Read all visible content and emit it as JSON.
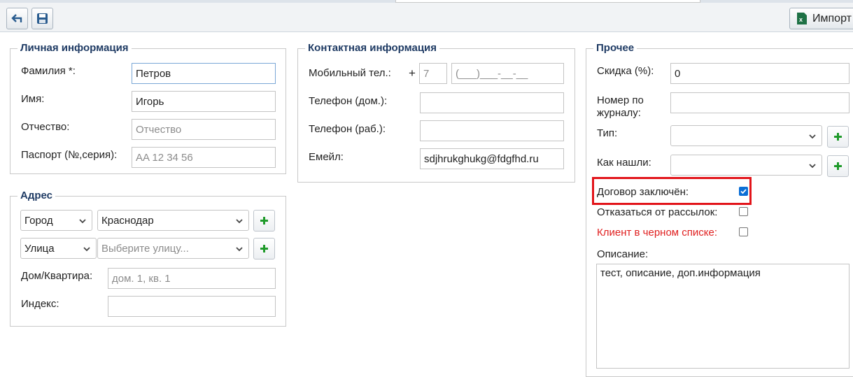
{
  "toolbar": {
    "back_icon": "arrow-back-icon",
    "save_icon": "floppy-disk-icon",
    "import_label": "Импорт",
    "import_icon": "excel-icon"
  },
  "personal": {
    "legend": "Личная информация",
    "lastname_label": "Фамилия *:",
    "lastname_value": "Петров",
    "firstname_label": "Имя:",
    "firstname_value": "Игорь",
    "middlename_label": "Отчество:",
    "middlename_placeholder": "Отчество",
    "passport_label": "Паспорт (№,серия):",
    "passport_placeholder": "AA 12 34 56"
  },
  "address": {
    "legend": "Адрес",
    "city_type": "Город",
    "city_value": "Краснодар",
    "street_type": "Улица",
    "street_placeholder": "Выберите улицу...",
    "house_label": "Дом/Квартира:",
    "house_placeholder": "дом. 1, кв. 1",
    "index_label": "Индекс:",
    "index_value": ""
  },
  "contact": {
    "legend": "Контактная информация",
    "mobile_label": "Мобильный тел.:",
    "mobile_plus": "+",
    "mobile_code_placeholder": "7",
    "mobile_number_placeholder": "(___)___-__-__",
    "home_phone_label": "Телефон (дом.):",
    "work_phone_label": "Телефон (раб.):",
    "email_label": "Емейл:",
    "email_value": "sdjhrukghukg@fdgfhd.ru"
  },
  "other": {
    "legend": "Прочее",
    "discount_label": "Скидка (%):",
    "discount_value": "0",
    "journal_label_1": "Номер по",
    "journal_label_2": "журналу:",
    "type_label": "Тип:",
    "source_label": "Как нашли:",
    "contract_label": "Договор заключён:",
    "contract_checked": true,
    "unsubscribe_label": "Отказаться от рассылок:",
    "unsubscribe_checked": false,
    "blacklist_label": "Клиент в черном списке:",
    "blacklist_checked": false,
    "description_label": "Описание:",
    "description_value": "тест, описание, доп.информация"
  },
  "colors": {
    "legend": "#1f3b64",
    "blacklist": "#e02020",
    "highlight": "#e2141a",
    "plus_green": "#1f9a2a",
    "checkbox_blue": "#0b6fd6"
  }
}
